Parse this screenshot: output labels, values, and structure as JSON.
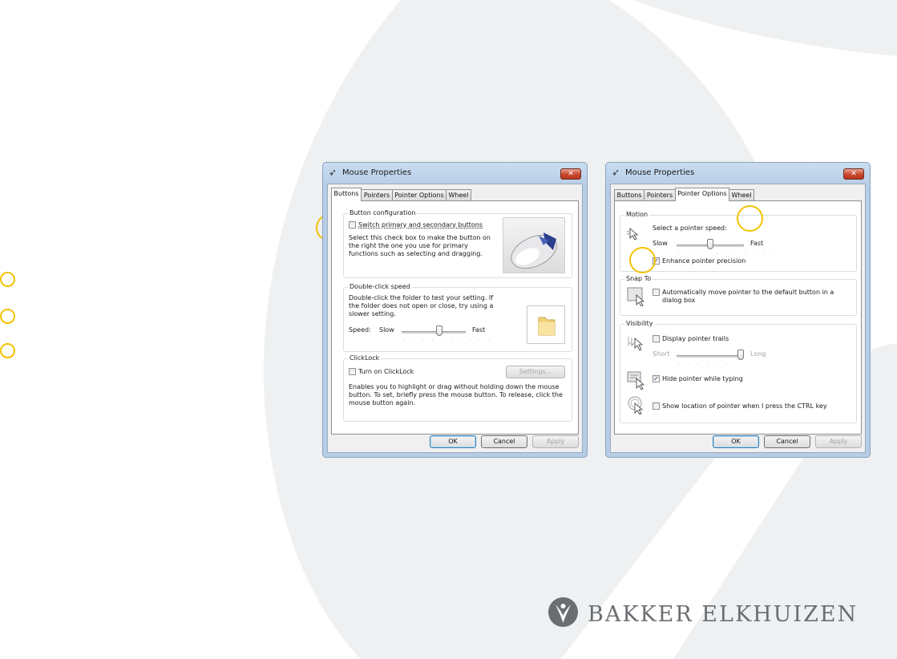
{
  "colors": {
    "marker": "#f2c200",
    "background_shape": "#eef0f1",
    "logo": "#6b6e71",
    "title_bar": "#b9cfe8",
    "close_button": "#c9462c"
  },
  "dialog_left": {
    "title": "Mouse Properties",
    "close_glyph": "✕",
    "tabs": [
      {
        "label": "Buttons",
        "active": true
      },
      {
        "label": "Pointers",
        "active": false
      },
      {
        "label": "Pointer Options",
        "active": false
      },
      {
        "label": "Wheel",
        "active": false
      }
    ],
    "button_configuration": {
      "group_label": "Button configuration",
      "checkbox_label": "Switch primary and secondary buttons",
      "checked": false,
      "description": "Select this check box to make the button on the right the one you use for primary functions such as selecting and dragging."
    },
    "double_click": {
      "group_label": "Double-click speed",
      "description": "Double-click the folder to test your setting. If the folder does not open or close, try using a slower setting.",
      "speed_label": "Speed:",
      "slow_label": "Slow",
      "fast_label": "Fast",
      "slider_level": 0.6
    },
    "clicklock": {
      "group_label": "ClickLock",
      "checkbox_label": "Turn on ClickLock",
      "checked": false,
      "settings_button": "Settings...",
      "description": "Enables you to highlight or drag without holding down the mouse button. To set, briefly press the mouse button. To release, click the mouse button again."
    },
    "buttons": {
      "ok": "OK",
      "cancel": "Cancel",
      "apply": "Apply"
    }
  },
  "dialog_right": {
    "title": "Mouse Properties",
    "close_glyph": "✕",
    "tabs": [
      {
        "label": "Buttons",
        "active": false
      },
      {
        "label": "Pointers",
        "active": false
      },
      {
        "label": "Pointer Options",
        "active": true
      },
      {
        "label": "Wheel",
        "active": false
      }
    ],
    "motion": {
      "group_label": "Motion",
      "prompt": "Select a pointer speed:",
      "slow_label": "Slow",
      "fast_label": "Fast",
      "slider_level": 0.5,
      "precision_label": "Enhance pointer precision",
      "precision_checked": true
    },
    "snap_to": {
      "group_label": "Snap To",
      "checkbox_label": "Automatically move pointer to the default button in a dialog box",
      "checked": false
    },
    "visibility": {
      "group_label": "Visibility",
      "trails_label": "Display pointer trails",
      "trails_checked": false,
      "short_label": "Short",
      "long_label": "Long",
      "trails_level": 1.0,
      "hide_label": "Hide pointer while typing",
      "hide_checked": true,
      "ctrl_label": "Show location of pointer when I press the CTRL key",
      "ctrl_checked": false
    },
    "buttons": {
      "ok": "OK",
      "cancel": "Cancel",
      "apply": "Apply"
    }
  },
  "logo": {
    "text": "BAKKER ELKHUIZEN"
  }
}
